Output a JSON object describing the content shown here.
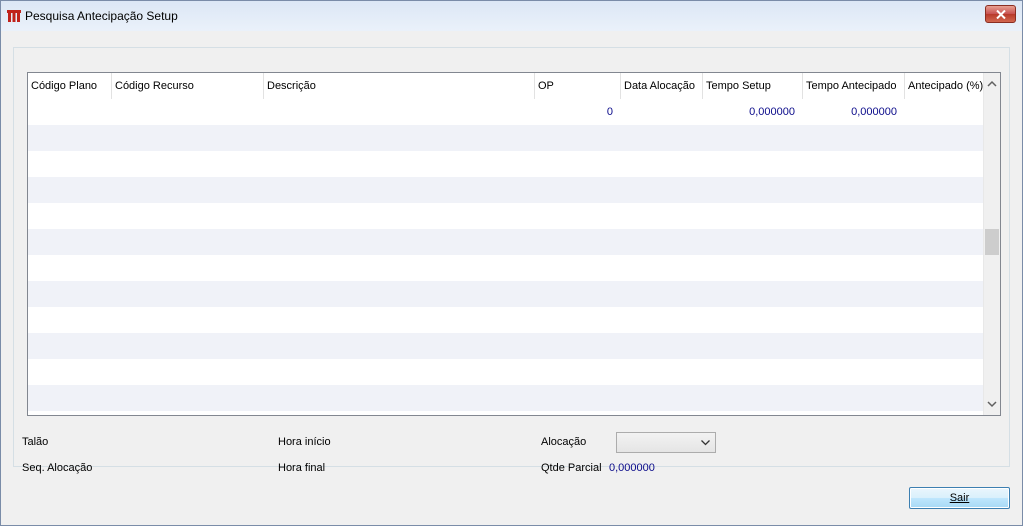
{
  "window": {
    "title": "Pesquisa Antecipação Setup",
    "close_icon": "close-icon"
  },
  "grid": {
    "columns": [
      {
        "label": "Código Plano"
      },
      {
        "label": "Código Recurso"
      },
      {
        "label": "Descrição"
      },
      {
        "label": "OP"
      },
      {
        "label": "Data Alocação"
      },
      {
        "label": "Tempo Setup"
      },
      {
        "label": "Tempo Antecipado"
      },
      {
        "label": "Antecipado (%)"
      }
    ],
    "rows": [
      {
        "op": "0",
        "tempo_setup": "0,000000",
        "tempo_antecipado": "0,000000"
      }
    ]
  },
  "form": {
    "talao_label": "Talão",
    "seq_alocacao_label": "Seq. Alocação",
    "hora_inicio_label": "Hora início",
    "hora_final_label": "Hora final",
    "alocacao_label": "Alocação",
    "alocacao_value": "",
    "qtde_parcial_label": "Qtde Parcial",
    "qtde_parcial_value": "0,000000"
  },
  "buttons": {
    "sair_label": "Sair"
  },
  "colors": {
    "value_text": "#0a0a8a",
    "alt_row": "#f0f2f8"
  }
}
